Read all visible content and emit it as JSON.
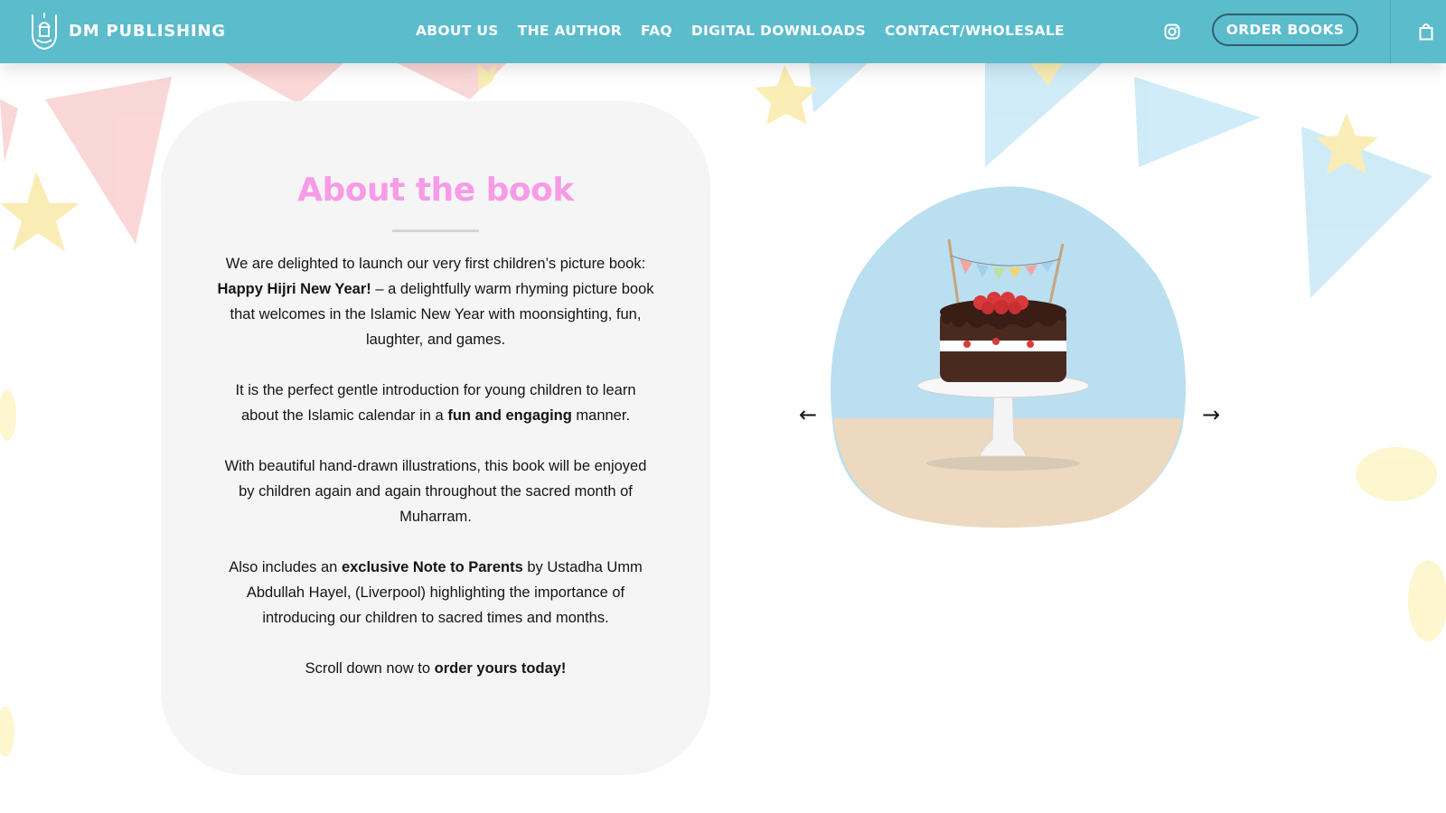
{
  "brand": {
    "name": "DM PUBLISHING",
    "logo_icon": "lantern-logo-icon"
  },
  "nav": {
    "items": [
      "ABOUT US",
      "THE AUTHOR",
      "FAQ",
      "DIGITAL DOWNLOADS",
      "CONTACT/WHOLESALE"
    ]
  },
  "header": {
    "instagram_icon": "instagram-icon",
    "order_button": "ORDER BOOKS",
    "cart_icon": "shopping-bag-icon"
  },
  "about": {
    "title": "About the book",
    "p1_a": "We are delighted to launch our very first children’s picture book: ",
    "p1_b": "Happy Hijri New Year!",
    "p1_c": " – a delightfully warm rhyming picture book that welcomes in the Islamic New Year with moonsighting, fun, laughter, and games.",
    "p2_a": "It is the perfect gentle introduction for young children to learn about the Islamic calendar in a ",
    "p2_b": "fun and engaging",
    "p2_c": " manner.",
    "p3": "With beautiful hand-drawn illustrations, this book will be enjoyed by children again and again throughout the sacred month of Muharram.",
    "p4_a": "Also includes an ",
    "p4_b": "exclusive Note to Parents",
    "p4_c": " by Ustadha Umm Abdullah Hayel, (Liverpool) highlighting the importance of introducing our children to sacred times and months.",
    "p5_a": "Scroll down now to ",
    "p5_b": "order yours today!"
  },
  "carousel": {
    "prev_arrow": "←",
    "next_arrow": "→",
    "image": "cake-illustration"
  },
  "colors": {
    "header_bg": "#5bbccc",
    "title_pink": "#f79be7",
    "card_bg": "#f5f5f5"
  }
}
